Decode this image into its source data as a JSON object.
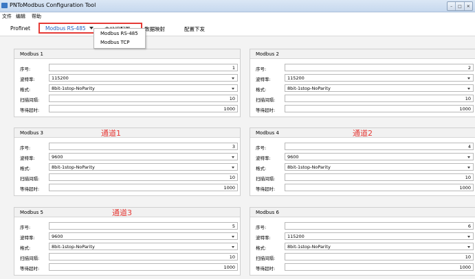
{
  "window": {
    "title": "PNToModbus Configuration Tool"
  },
  "menu": [
    "文件",
    "编辑",
    "帮助"
  ],
  "tabs": [
    "Profinet",
    "Modbus RS-485",
    "主站组配置",
    "数据映射",
    "配置下发"
  ],
  "dropdown": {
    "items": [
      "Modbus RS-485",
      "Modbus TCP"
    ]
  },
  "labels": {
    "serial": "序号:",
    "baud": "波特率:",
    "format": "格式:",
    "scan_interval": "扫描间隔:",
    "timeout": "等待超时:"
  },
  "groups": [
    {
      "title": "Modbus 1",
      "serial": "1",
      "baud": "115200",
      "format": "8bit-1stop-NoParity",
      "scan_interval": "10",
      "timeout": "1000"
    },
    {
      "title": "Modbus 2",
      "serial": "2",
      "baud": "115200",
      "format": "8bit-1stop-NoParity",
      "scan_interval": "10",
      "timeout": "1000"
    },
    {
      "title": "Modbus 3",
      "serial": "3",
      "baud": "9600",
      "format": "8bit-1stop-NoParity",
      "scan_interval": "10",
      "timeout": "1000"
    },
    {
      "title": "Modbus 4",
      "serial": "4",
      "baud": "9600",
      "format": "8bit-1stop-NoParity",
      "scan_interval": "10",
      "timeout": "1000"
    },
    {
      "title": "Modbus 5",
      "serial": "5",
      "baud": "9600",
      "format": "8bit-1stop-NoParity",
      "scan_interval": "10",
      "timeout": "1000"
    },
    {
      "title": "Modbus 6",
      "serial": "6",
      "baud": "115200",
      "format": "8bit-1stop-NoParity",
      "scan_interval": "10",
      "timeout": "1000"
    }
  ],
  "annotations": [
    "通道1",
    "通道2",
    "通道3"
  ],
  "colors": {
    "annotation": "#e53935",
    "active_tab": "#1f5fbf"
  }
}
